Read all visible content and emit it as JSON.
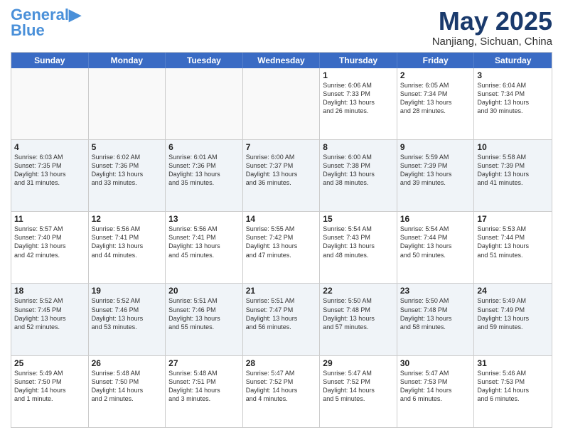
{
  "logo": {
    "line1": "General",
    "line2": "Blue"
  },
  "title": "May 2025",
  "subtitle": "Nanjiang, Sichuan, China",
  "weekdays": [
    "Sunday",
    "Monday",
    "Tuesday",
    "Wednesday",
    "Thursday",
    "Friday",
    "Saturday"
  ],
  "rows": [
    [
      {
        "day": "",
        "info": ""
      },
      {
        "day": "",
        "info": ""
      },
      {
        "day": "",
        "info": ""
      },
      {
        "day": "",
        "info": ""
      },
      {
        "day": "1",
        "info": "Sunrise: 6:06 AM\nSunset: 7:33 PM\nDaylight: 13 hours\nand 26 minutes."
      },
      {
        "day": "2",
        "info": "Sunrise: 6:05 AM\nSunset: 7:34 PM\nDaylight: 13 hours\nand 28 minutes."
      },
      {
        "day": "3",
        "info": "Sunrise: 6:04 AM\nSunset: 7:34 PM\nDaylight: 13 hours\nand 30 minutes."
      }
    ],
    [
      {
        "day": "4",
        "info": "Sunrise: 6:03 AM\nSunset: 7:35 PM\nDaylight: 13 hours\nand 31 minutes."
      },
      {
        "day": "5",
        "info": "Sunrise: 6:02 AM\nSunset: 7:36 PM\nDaylight: 13 hours\nand 33 minutes."
      },
      {
        "day": "6",
        "info": "Sunrise: 6:01 AM\nSunset: 7:36 PM\nDaylight: 13 hours\nand 35 minutes."
      },
      {
        "day": "7",
        "info": "Sunrise: 6:00 AM\nSunset: 7:37 PM\nDaylight: 13 hours\nand 36 minutes."
      },
      {
        "day": "8",
        "info": "Sunrise: 6:00 AM\nSunset: 7:38 PM\nDaylight: 13 hours\nand 38 minutes."
      },
      {
        "day": "9",
        "info": "Sunrise: 5:59 AM\nSunset: 7:39 PM\nDaylight: 13 hours\nand 39 minutes."
      },
      {
        "day": "10",
        "info": "Sunrise: 5:58 AM\nSunset: 7:39 PM\nDaylight: 13 hours\nand 41 minutes."
      }
    ],
    [
      {
        "day": "11",
        "info": "Sunrise: 5:57 AM\nSunset: 7:40 PM\nDaylight: 13 hours\nand 42 minutes."
      },
      {
        "day": "12",
        "info": "Sunrise: 5:56 AM\nSunset: 7:41 PM\nDaylight: 13 hours\nand 44 minutes."
      },
      {
        "day": "13",
        "info": "Sunrise: 5:56 AM\nSunset: 7:41 PM\nDaylight: 13 hours\nand 45 minutes."
      },
      {
        "day": "14",
        "info": "Sunrise: 5:55 AM\nSunset: 7:42 PM\nDaylight: 13 hours\nand 47 minutes."
      },
      {
        "day": "15",
        "info": "Sunrise: 5:54 AM\nSunset: 7:43 PM\nDaylight: 13 hours\nand 48 minutes."
      },
      {
        "day": "16",
        "info": "Sunrise: 5:54 AM\nSunset: 7:44 PM\nDaylight: 13 hours\nand 50 minutes."
      },
      {
        "day": "17",
        "info": "Sunrise: 5:53 AM\nSunset: 7:44 PM\nDaylight: 13 hours\nand 51 minutes."
      }
    ],
    [
      {
        "day": "18",
        "info": "Sunrise: 5:52 AM\nSunset: 7:45 PM\nDaylight: 13 hours\nand 52 minutes."
      },
      {
        "day": "19",
        "info": "Sunrise: 5:52 AM\nSunset: 7:46 PM\nDaylight: 13 hours\nand 53 minutes."
      },
      {
        "day": "20",
        "info": "Sunrise: 5:51 AM\nSunset: 7:46 PM\nDaylight: 13 hours\nand 55 minutes."
      },
      {
        "day": "21",
        "info": "Sunrise: 5:51 AM\nSunset: 7:47 PM\nDaylight: 13 hours\nand 56 minutes."
      },
      {
        "day": "22",
        "info": "Sunrise: 5:50 AM\nSunset: 7:48 PM\nDaylight: 13 hours\nand 57 minutes."
      },
      {
        "day": "23",
        "info": "Sunrise: 5:50 AM\nSunset: 7:48 PM\nDaylight: 13 hours\nand 58 minutes."
      },
      {
        "day": "24",
        "info": "Sunrise: 5:49 AM\nSunset: 7:49 PM\nDaylight: 13 hours\nand 59 minutes."
      }
    ],
    [
      {
        "day": "25",
        "info": "Sunrise: 5:49 AM\nSunset: 7:50 PM\nDaylight: 14 hours\nand 1 minute."
      },
      {
        "day": "26",
        "info": "Sunrise: 5:48 AM\nSunset: 7:50 PM\nDaylight: 14 hours\nand 2 minutes."
      },
      {
        "day": "27",
        "info": "Sunrise: 5:48 AM\nSunset: 7:51 PM\nDaylight: 14 hours\nand 3 minutes."
      },
      {
        "day": "28",
        "info": "Sunrise: 5:47 AM\nSunset: 7:52 PM\nDaylight: 14 hours\nand 4 minutes."
      },
      {
        "day": "29",
        "info": "Sunrise: 5:47 AM\nSunset: 7:52 PM\nDaylight: 14 hours\nand 5 minutes."
      },
      {
        "day": "30",
        "info": "Sunrise: 5:47 AM\nSunset: 7:53 PM\nDaylight: 14 hours\nand 6 minutes."
      },
      {
        "day": "31",
        "info": "Sunrise: 5:46 AM\nSunset: 7:53 PM\nDaylight: 14 hours\nand 6 minutes."
      }
    ]
  ]
}
